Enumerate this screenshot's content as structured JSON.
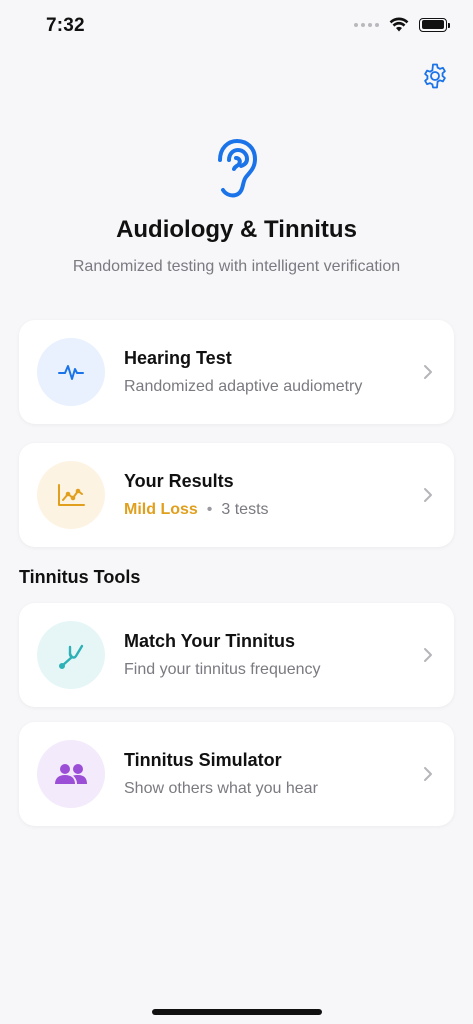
{
  "status_bar": {
    "time": "7:32"
  },
  "header": {
    "title": "Audiology & Tinnitus",
    "subtitle": "Randomized testing with intelligent verification"
  },
  "colors": {
    "accent": "#1a73e8",
    "results_status": "#e0a01e",
    "hearing_icon_bg": "#e8f1fd",
    "results_icon_bg": "#fdf3e3",
    "match_icon_bg": "#e6f6f6",
    "sim_icon_bg": "#f3eafb"
  },
  "cards": {
    "hearing_test": {
      "icon": "waveform-icon",
      "title": "Hearing Test",
      "subtitle": "Randomized adaptive audiometry"
    },
    "results": {
      "icon": "chart-line-icon",
      "title": "Your Results",
      "status": "Mild Loss",
      "separator": "•",
      "count": "3 tests"
    }
  },
  "tinnitus_section": {
    "title": "Tinnitus Tools",
    "match": {
      "icon": "tuning-fork-icon",
      "title": "Match Your Tinnitus",
      "subtitle": "Find your tinnitus frequency"
    },
    "simulator": {
      "icon": "people-icon",
      "title": "Tinnitus Simulator",
      "subtitle": "Show others what you hear"
    }
  }
}
